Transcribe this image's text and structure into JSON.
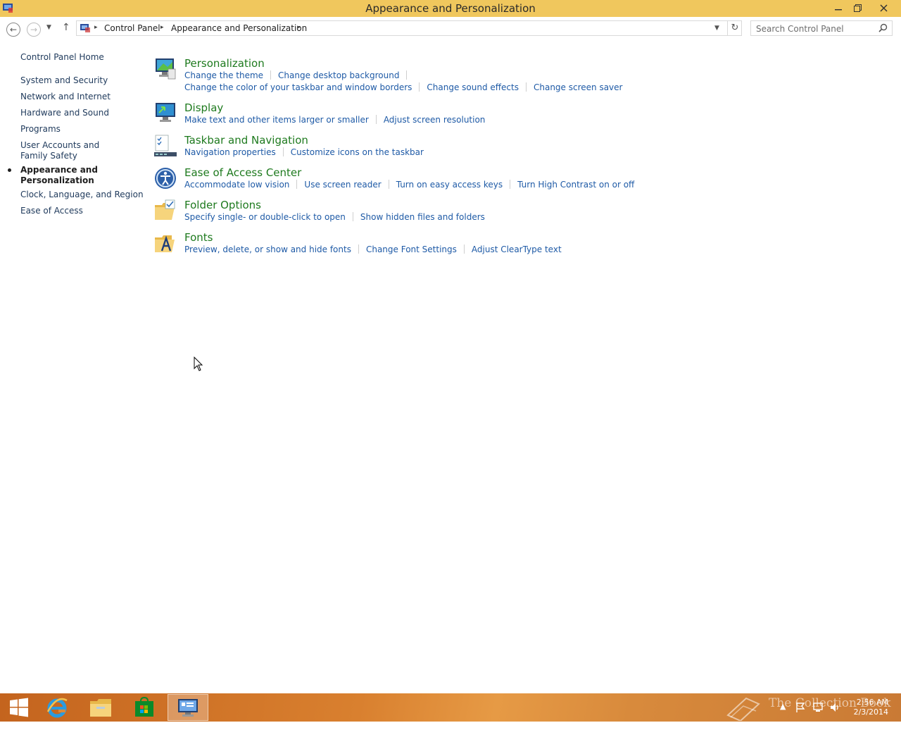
{
  "window": {
    "title": "Appearance and Personalization"
  },
  "address": {
    "crumbs": [
      "Control Panel",
      "Appearance and Personalization"
    ],
    "search_placeholder": "Search Control Panel"
  },
  "leftnav": {
    "home": "Control Panel Home",
    "items": [
      "System and Security",
      "Network and Internet",
      "Hardware and Sound",
      "Programs",
      "User Accounts and Family Safety",
      "Appearance and Personalization",
      "Clock, Language, and Region",
      "Ease of Access"
    ],
    "current_index": 5
  },
  "categories": [
    {
      "title": "Personalization",
      "icon": "personalization-icon",
      "link_rows": [
        [
          "Change the theme",
          "Change desktop background"
        ],
        [
          "Change the color of your taskbar and window borders",
          "Change sound effects",
          "Change screen saver"
        ]
      ]
    },
    {
      "title": "Display",
      "icon": "display-icon",
      "link_rows": [
        [
          "Make text and other items larger or smaller",
          "Adjust screen resolution"
        ]
      ]
    },
    {
      "title": "Taskbar and Navigation",
      "icon": "taskbar-icon",
      "link_rows": [
        [
          "Navigation properties",
          "Customize icons on the taskbar"
        ]
      ]
    },
    {
      "title": "Ease of Access Center",
      "icon": "ease-of-access-icon",
      "link_rows": [
        [
          "Accommodate low vision",
          "Use screen reader",
          "Turn on easy access keys",
          "Turn High Contrast on or off"
        ]
      ]
    },
    {
      "title": "Folder Options",
      "icon": "folder-options-icon",
      "link_rows": [
        [
          "Specify single- or double-click to open",
          "Show hidden files and folders"
        ]
      ]
    },
    {
      "title": "Fonts",
      "icon": "fonts-icon",
      "link_rows": [
        [
          "Preview, delete, or show and hide fonts",
          "Change Font Settings",
          "Adjust ClearType text"
        ]
      ]
    }
  ],
  "taskbar": {
    "time": "2:56 AM",
    "date": "2/3/2014",
    "watermark": "The Collection Book"
  },
  "colors": {
    "titlebar": "#f0c75d",
    "category_title": "#1e7a1e",
    "link": "#1e5aa6",
    "nav_link": "#1e395b"
  }
}
